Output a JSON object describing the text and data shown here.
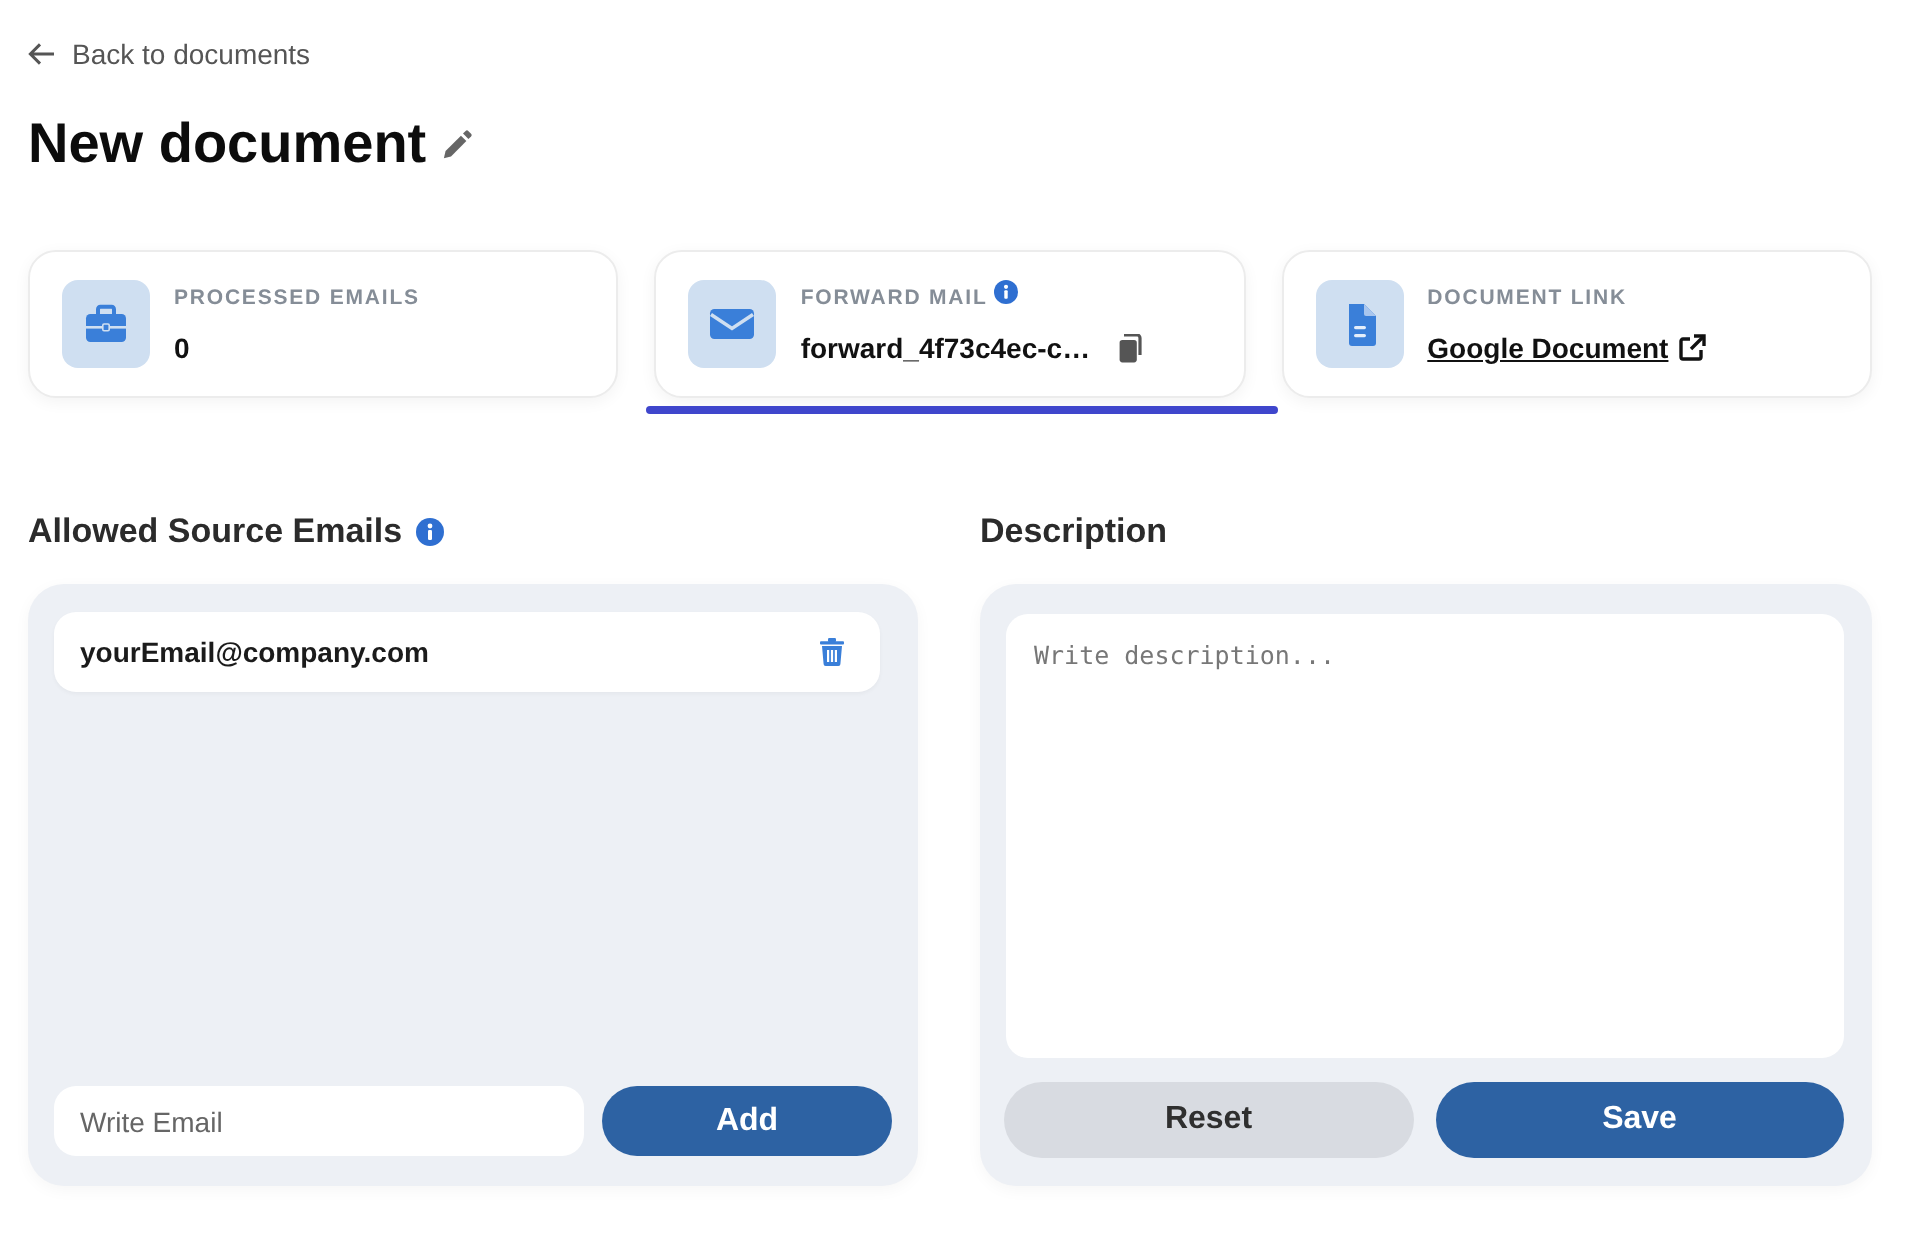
{
  "back_link": {
    "label": "Back to documents"
  },
  "title": "New document",
  "stat_cards": [
    {
      "kind": "count",
      "label": "PROCESSED EMAILS",
      "value": "0",
      "info": false,
      "selected": false
    },
    {
      "kind": "email",
      "label": "FORWARD MAIL",
      "value": "forward_4f73c4ec-c…",
      "info": true,
      "selected": true
    },
    {
      "kind": "link",
      "label": "DOCUMENT LINK",
      "value": "Google Document",
      "info": false,
      "selected": false
    }
  ],
  "sources": {
    "heading": "Allowed Source Emails",
    "info": true,
    "emails": [
      {
        "address": "yourEmail@company.com"
      }
    ],
    "input": {
      "placeholder": "Write Email"
    },
    "button": "Add"
  },
  "description": {
    "heading": "Description",
    "placeholder": "Write description...",
    "buttons": [
      {
        "kind": "secondary",
        "label": "Reset"
      },
      {
        "kind": "primary",
        "label": "Save"
      }
    ]
  }
}
